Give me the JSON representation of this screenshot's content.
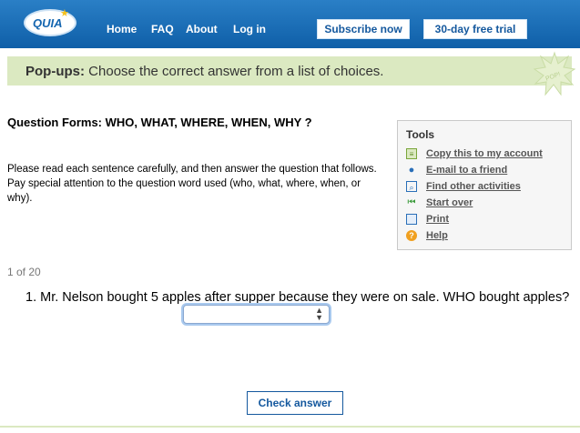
{
  "header": {
    "logo": "QUIA",
    "nav": [
      "Home",
      "FAQ",
      "About",
      "Log in"
    ],
    "subscribe": "Subscribe now",
    "trial": "30-day free trial"
  },
  "popups": {
    "label": "Pop-ups:",
    "text": "Choose the correct answer from a list of choices."
  },
  "activity": {
    "title": "Question Forms: WHO, WHAT, WHERE, WHEN, WHY ?",
    "instructions": "Please read each sentence carefully, and then answer the question that follows. Pay special attention to the question word used (who, what, where, when, or why)."
  },
  "tools": {
    "heading": "Tools",
    "items": [
      {
        "label": "Copy this to my account",
        "icon": "copy-icon"
      },
      {
        "label": "E-mail to a friend",
        "icon": "person-icon"
      },
      {
        "label": "Find other activities",
        "icon": "search-icon"
      },
      {
        "label": "Start over",
        "icon": "rewind-icon"
      },
      {
        "label": "Print",
        "icon": "print-icon"
      },
      {
        "label": "Help",
        "icon": "help-icon"
      }
    ]
  },
  "question": {
    "counter": "1 of 20",
    "number": "1.",
    "text": "Mr. Nelson bought 5 apples after supper because they were on sale. WHO bought apples?"
  },
  "check_button": "Check answer"
}
